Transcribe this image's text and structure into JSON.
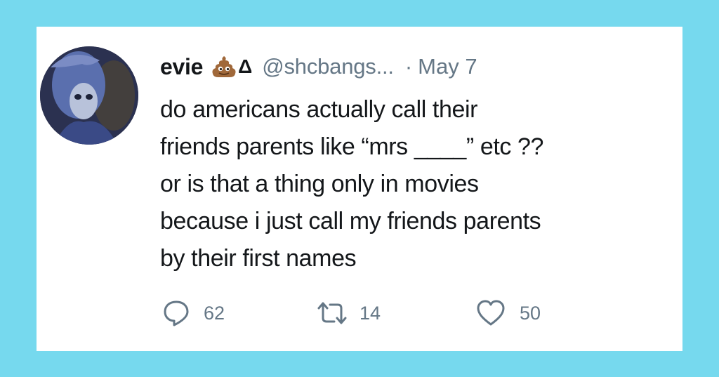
{
  "tweet": {
    "author_name": "evie",
    "author_emoji": "poop-emoji",
    "author_symbol": "Δ",
    "handle": "@shcbangs...",
    "separator": "·",
    "date": "May 7",
    "text_lines": [
      "do americans actually call their",
      "friends parents like “mrs ____” etc ??",
      "or is that a thing only in movies",
      "because i just call my friends parents",
      "by their first names"
    ]
  },
  "actions": {
    "reply_count": "62",
    "retweet_count": "14",
    "like_count": "50"
  },
  "colors": {
    "background": "#76d9ee",
    "card": "#ffffff",
    "text": "#14171a",
    "muted": "#657786"
  }
}
